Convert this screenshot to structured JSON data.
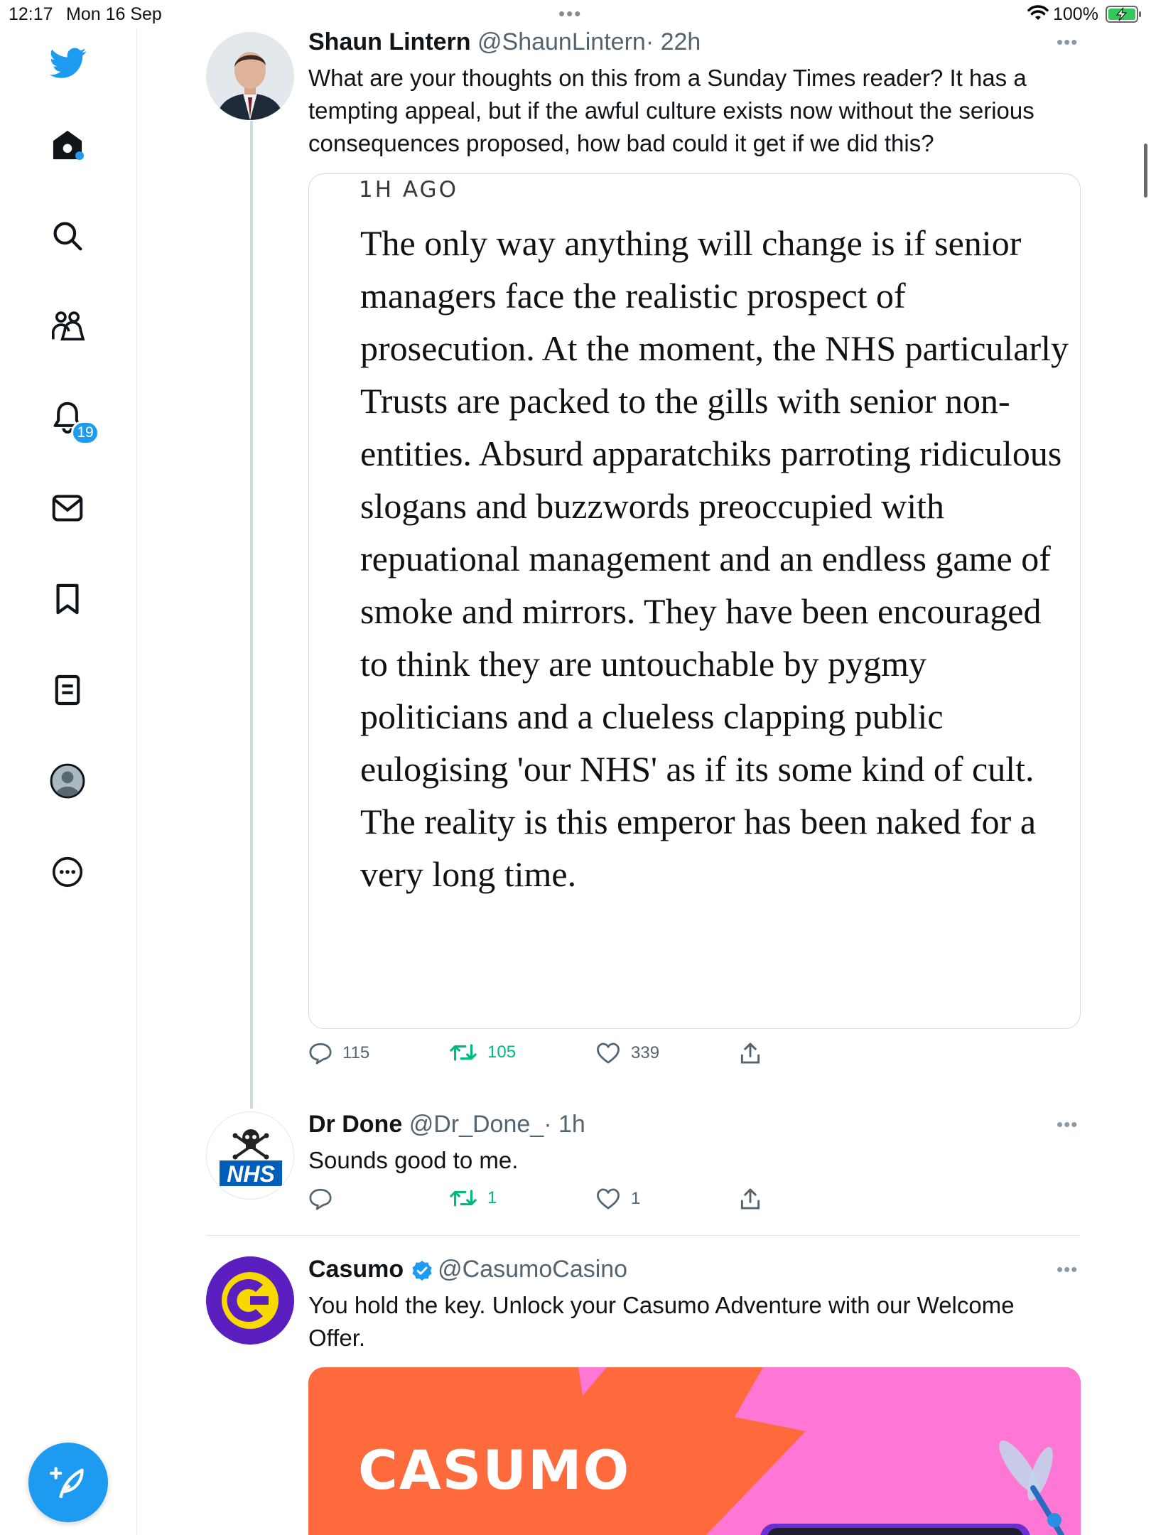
{
  "status_bar": {
    "time": "12:17",
    "date": "Mon 16 Sep",
    "battery": "100%"
  },
  "sidebar": {
    "notifications_count": "19",
    "accent_color": "#1d9bf0",
    "items": [
      "twitter-logo-icon",
      "home-icon",
      "search-icon",
      "communities-icon",
      "notifications-icon",
      "messages-icon",
      "bookmarks-icon",
      "lists-icon",
      "profile-icon",
      "more-icon"
    ]
  },
  "tweets": [
    {
      "name": "Shaun Lintern",
      "handle": "@ShaunLintern",
      "time": "· 22h",
      "text": "What are your thoughts on this from a Sunday Times reader? It has a tempting appeal, but if the awful culture exists now without the serious consequences proposed, how bad could it get if we did this?",
      "quote": {
        "ago": "1H AGO",
        "text": "The only way anything will change is if senior managers face the realistic prospect of prosecution. At the moment, the NHS particularly Trusts are packed to the gills with senior non-entities. Absurd apparatchiks parroting ridiculous slogans and buzzwords preoccupied with repuational management and an endless game of smoke and mirrors.  They have been encouraged to think they are untouchable by pygmy politicians and a clueless clapping public eulogising 'our NHS' as if its some kind of cult. The reality is this emperor has been naked for a very long time."
      },
      "replies": "115",
      "retweets": "105",
      "likes": "339"
    },
    {
      "name": "Dr Done",
      "handle": "@Dr_Done_",
      "time": "· 1h",
      "text": "Sounds good to me.",
      "avatar_text": "NHS",
      "replies": "",
      "retweets": "1",
      "likes": "1"
    },
    {
      "name": "Casumo",
      "handle": "@CasumoCasino",
      "text": "You hold the key. Unlock your Casumo Adventure with our Welcome Offer.",
      "promo_logo": "CASUMO"
    }
  ]
}
